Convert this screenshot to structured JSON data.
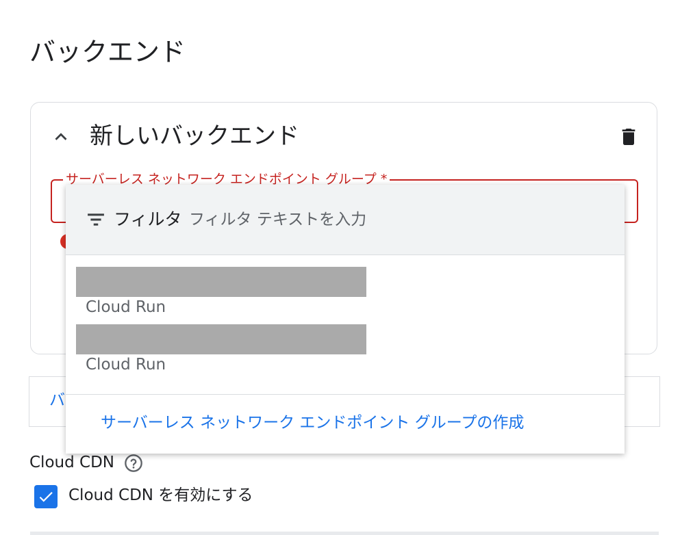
{
  "page": {
    "title": "バックエンド"
  },
  "backend_card": {
    "title": "新しいバックエンド",
    "neg_field": {
      "label": "サーバーレス ネットワーク エンドポイント グループ *"
    }
  },
  "dropdown": {
    "filter": {
      "label": "フィルタ",
      "placeholder": "フィルタ テキストを入力"
    },
    "options": [
      {
        "subtitle": "Cloud Run"
      },
      {
        "subtitle": "Cloud Run"
      }
    ],
    "create_link": "サーバーレス ネットワーク エンドポイント グループの作成"
  },
  "backend_row": {
    "visible_text": "バ"
  },
  "cdn": {
    "heading": "Cloud CDN",
    "checkbox_label": "Cloud CDN を有効にする",
    "checkbox_checked": true
  },
  "colors": {
    "accent": "#1a73e8",
    "error": "#c5221f",
    "border": "#dadce0"
  }
}
